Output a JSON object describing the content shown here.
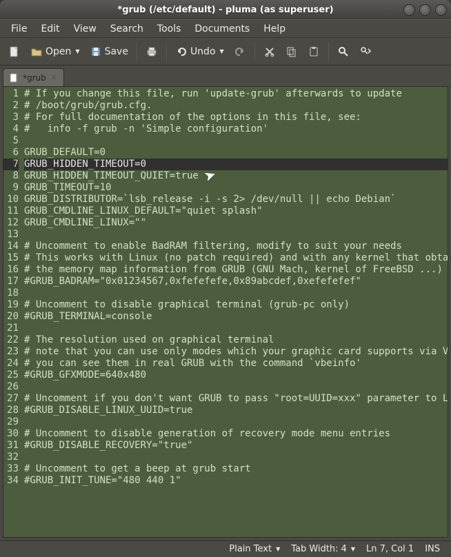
{
  "window": {
    "title": "*grub (/etc/default) - pluma (as superuser)"
  },
  "menu": {
    "file": "File",
    "edit": "Edit",
    "view": "View",
    "search": "Search",
    "tools": "Tools",
    "documents": "Documents",
    "help": "Help"
  },
  "toolbar": {
    "open_label": "Open",
    "save_label": "Save",
    "undo_label": "Undo"
  },
  "tab": {
    "label": "*grub"
  },
  "editor": {
    "current_line": 7,
    "lines": [
      "# If you change this file, run 'update-grub' afterwards to update",
      "# /boot/grub/grub.cfg.",
      "# For full documentation of the options in this file, see:",
      "#   info -f grub -n 'Simple configuration'",
      "",
      "GRUB_DEFAULT=0",
      "GRUB_HIDDEN_TIMEOUT=0",
      "GRUB_HIDDEN_TIMEOUT_QUIET=true",
      "GRUB_TIMEOUT=10",
      "GRUB_DISTRIBUTOR=`lsb_release -i -s 2> /dev/null || echo Debian`",
      "GRUB_CMDLINE_LINUX_DEFAULT=\"quiet splash\"",
      "GRUB_CMDLINE_LINUX=\"\"",
      "",
      "# Uncomment to enable BadRAM filtering, modify to suit your needs",
      "# This works with Linux (no patch required) and with any kernel that obtains",
      "# the memory map information from GRUB (GNU Mach, kernel of FreeBSD ...)",
      "#GRUB_BADRAM=\"0x01234567,0xfefefefe,0x89abcdef,0xefefefef\"",
      "",
      "# Uncomment to disable graphical terminal (grub-pc only)",
      "#GRUB_TERMINAL=console",
      "",
      "# The resolution used on graphical terminal",
      "# note that you can use only modes which your graphic card supports via VBE",
      "# you can see them in real GRUB with the command `vbeinfo'",
      "#GRUB_GFXMODE=640x480",
      "",
      "# Uncomment if you don't want GRUB to pass \"root=UUID=xxx\" parameter to Linux",
      "#GRUB_DISABLE_LINUX_UUID=true",
      "",
      "# Uncomment to disable generation of recovery mode menu entries",
      "#GRUB_DISABLE_RECOVERY=\"true\"",
      "",
      "# Uncomment to get a beep at grub start",
      "#GRUB_INIT_TUNE=\"480 440 1\""
    ]
  },
  "status": {
    "language": "Plain Text",
    "tab_width_label": "Tab Width:",
    "tab_width_value": "4",
    "position": "Ln 7, Col 1",
    "insert_mode": "INS"
  }
}
